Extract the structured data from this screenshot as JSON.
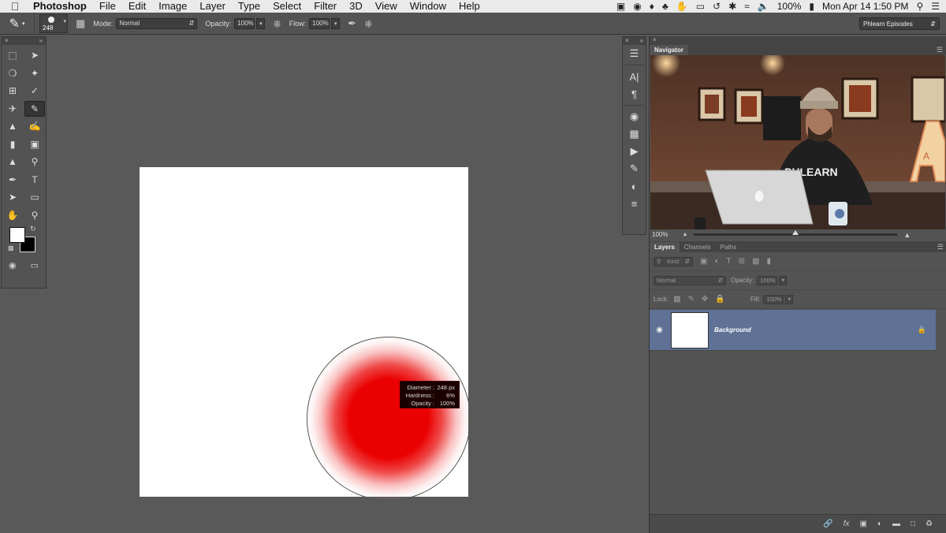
{
  "menubar": {
    "app_name": "Photoshop",
    "menus": [
      "File",
      "Edit",
      "Image",
      "Layer",
      "Type",
      "Select",
      "Filter",
      "3D",
      "View",
      "Window",
      "Help"
    ],
    "battery": "100%",
    "datetime": "Mon Apr 14  1:50 PM"
  },
  "options": {
    "brush_size": "248",
    "mode_label": "Mode:",
    "mode_value": "Normal",
    "opacity_label": "Opacity:",
    "opacity_value": "100%",
    "flow_label": "Flow:",
    "flow_value": "100%",
    "workspace": "Phlearn Episodes"
  },
  "brush_tooltip": {
    "diameter_label": "Diameter :",
    "diameter_value": "248 px",
    "hardness_label": "Hardness :",
    "hardness_value": "6%",
    "opacity_label": "Opacity :",
    "opacity_value": "100%",
    "brush_color": "#ea0000"
  },
  "navigator": {
    "tab": "Navigator",
    "zoom": "100%",
    "zoom_slider_fraction": 0.5,
    "shirt_text": "PHLEARN",
    "sign_letter": "A"
  },
  "layers": {
    "tabs": [
      "Layers",
      "Channels",
      "Paths"
    ],
    "filter_kind": "Kind",
    "blend_mode": "Normal",
    "opacity_label": "Opacity:",
    "opacity_value": "100%",
    "lock_label": "Lock:",
    "fill_label": "Fill:",
    "fill_value": "100%",
    "items": [
      {
        "name": "Background",
        "selected": true,
        "locked": true
      }
    ]
  },
  "colors": {
    "foreground": "#ffffff",
    "background": "#000000",
    "selected_layer": "#5f7195"
  }
}
